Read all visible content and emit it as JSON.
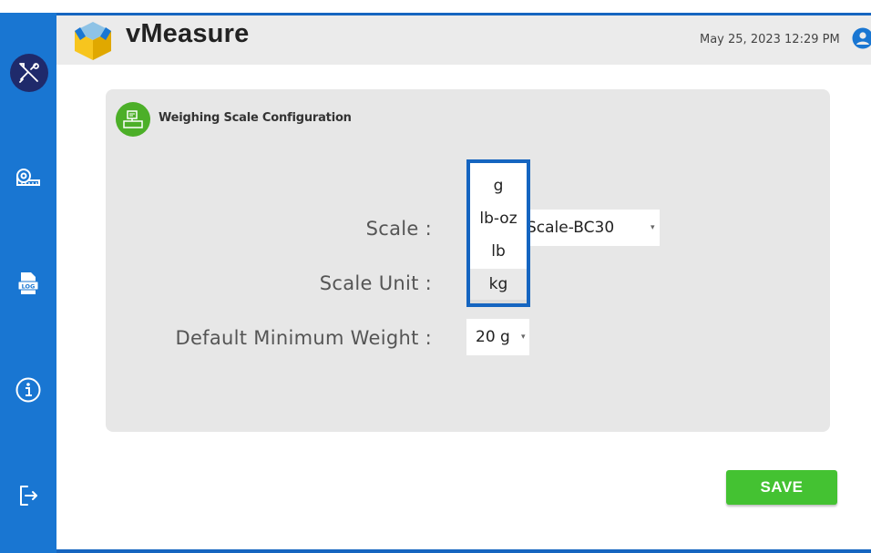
{
  "app": {
    "title": "vMeasure",
    "datetime": "May 25, 2023 12:29 PM"
  },
  "sidebar": {
    "items": [
      {
        "icon": "tools-icon",
        "active": true
      },
      {
        "icon": "measuring-tape-icon",
        "active": false
      },
      {
        "icon": "log-file-icon",
        "active": false
      },
      {
        "icon": "info-icon",
        "active": false
      },
      {
        "icon": "logout-icon",
        "active": false
      }
    ]
  },
  "card": {
    "title": "Weighing Scale Configuration",
    "icon": "scale-icon",
    "fields": {
      "scale_label": "Scale :",
      "scale_value": "Scale-BC30",
      "unit_label": "Scale Unit :",
      "min_weight_label": "Default Minimum Weight :",
      "min_weight_value": "20 g"
    }
  },
  "unit_dropdown": {
    "options": [
      "g",
      "lb-oz",
      "lb",
      "kg"
    ],
    "selected": "kg"
  },
  "actions": {
    "save_label": "SAVE"
  },
  "colors": {
    "sidebar": "#1976d2",
    "active_nav": "#1f2a6b",
    "header": "#ebebeb",
    "card": "#e7e7e7",
    "save": "#44c232",
    "highlight": "#1565c0"
  }
}
